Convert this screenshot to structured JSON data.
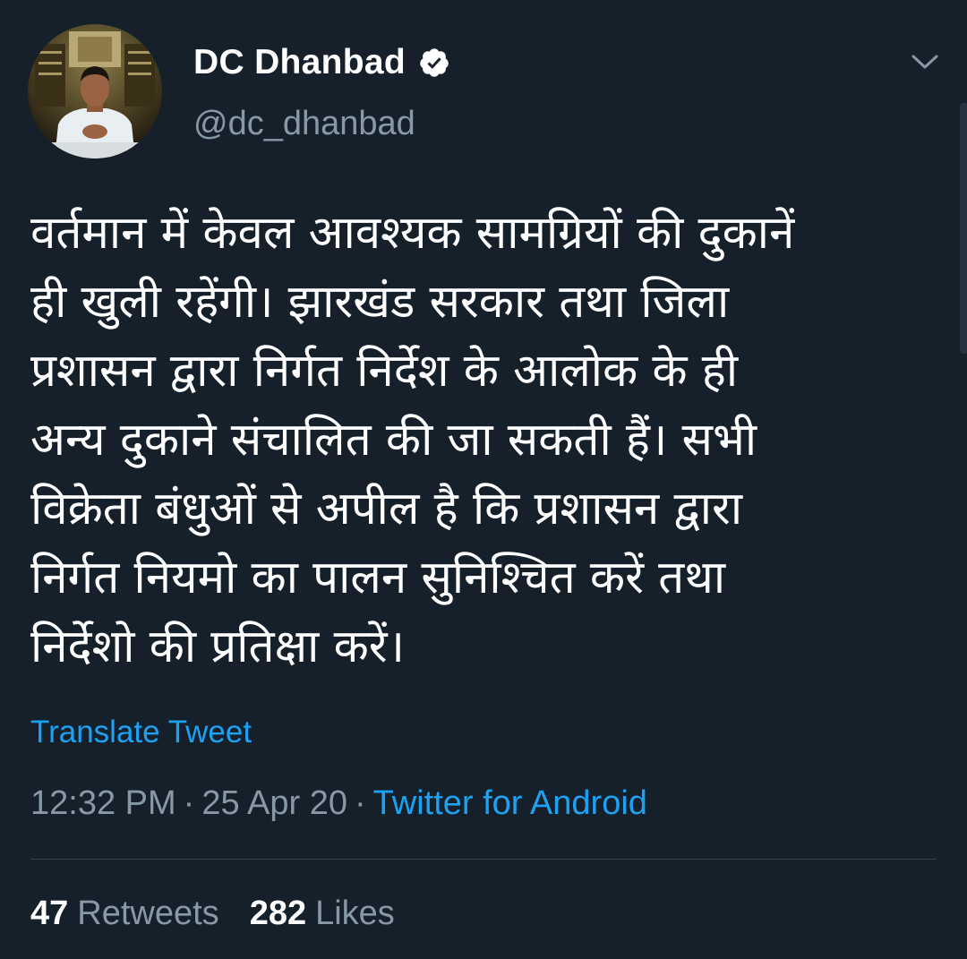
{
  "tweet": {
    "author": {
      "display_name": "DC Dhanbad",
      "handle": "@dc_dhanbad",
      "verified": true,
      "avatar_icon": "profile-photo"
    },
    "menu_icon": "chevron-down-icon",
    "text_lines": [
      "वर्तमान में केवल आवश्यक सामग्रियों की दुकानें",
      "ही खुली रहेंगी। झारखंड सरकार तथा जिला",
      "प्रशासन द्वारा निर्गत निर्देश के आलोक के ही",
      "अन्य दुकाने संचालित की जा सकती हैं। सभी",
      "विक्रेता बंधुओं से अपील है कि प्रशासन द्वारा",
      "निर्गत नियमो का पालन सुनिश्चित करें तथा",
      "निर्देशो की प्रतिक्षा करें।"
    ],
    "translate_label": "Translate Tweet",
    "time": "12:32 PM",
    "date": "25 Apr 20",
    "separator": "·",
    "source": "Twitter for Android",
    "stats": {
      "retweets_count": "47",
      "retweets_label": "Retweets",
      "likes_count": "282",
      "likes_label": "Likes"
    }
  },
  "colors": {
    "background": "#15202b",
    "text": "#ffffff",
    "secondary": "#8899a6",
    "accent": "#1da1f2",
    "divider": "#38444d"
  }
}
